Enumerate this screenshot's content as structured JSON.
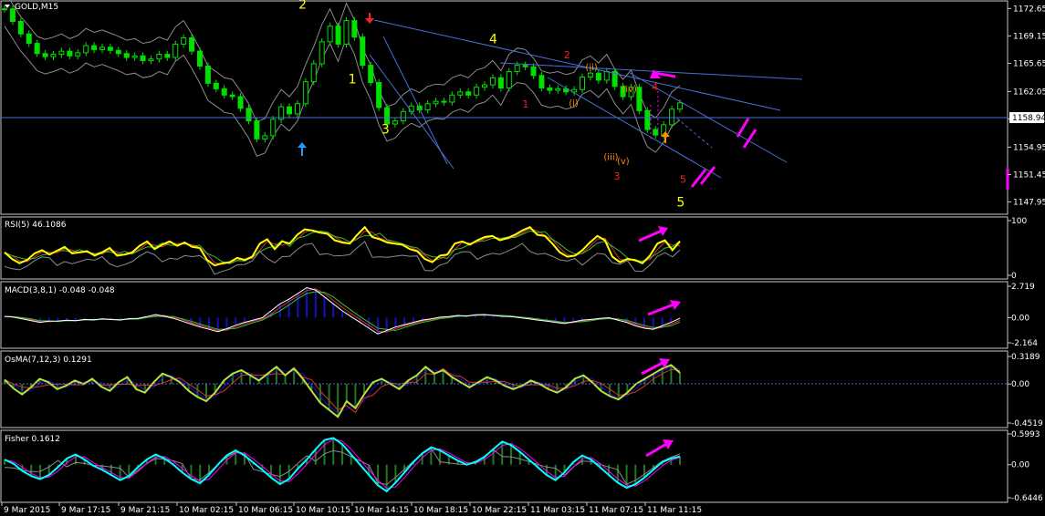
{
  "symbol_label": "GOLD,M15",
  "colors": {
    "background": "#000000",
    "frame": "#c8c8c8",
    "candle": "#00e000",
    "bands": "#8c8c8c",
    "trendline": "#4a6fd8",
    "current_price_line": "#4a6fd8",
    "arrow_annot": "#ff00ff",
    "rsi": "#ffff00",
    "histogram_blue": "#1010c8",
    "histogram_green": "#1f7a1f",
    "fisher_line": "#00ffff",
    "signal_magenta": "#ff00ff"
  },
  "chart_data": [
    {
      "type": "line",
      "panel": "main",
      "subtitle": "GOLD,M15",
      "y_ticks": [
        "1172.65",
        "1169.15",
        "1165.65",
        "1162.05",
        "1158.55",
        "1154.95",
        "1151.45",
        "1147.95"
      ],
      "current_price": "1158.94",
      "ylim": [
        1146.5,
        1173.5
      ],
      "series": [
        {
          "kind": "candles",
          "values": [
            1172.6,
            1171.0,
            1169.4,
            1168.2,
            1166.9,
            1166.5,
            1166.8,
            1167.2,
            1166.6,
            1167.0,
            1167.9,
            1167.4,
            1167.7,
            1167.3,
            1166.9,
            1166.4,
            1166.6,
            1166.0,
            1166.2,
            1166.8,
            1166.4,
            1168.1,
            1168.9,
            1167.2,
            1165.3,
            1163.1,
            1162.4,
            1161.6,
            1161.4,
            1159.9,
            1158.3,
            1156.0,
            1156.4,
            1158.5,
            1160.1,
            1159.2,
            1160.5,
            1163.3,
            1165.6,
            1168.4,
            1170.4,
            1168.1,
            1171.1,
            1169.0,
            1165.4,
            1163.2,
            1160.0,
            1157.9,
            1158.3,
            1159.5,
            1160.2,
            1159.7,
            1160.5,
            1160.8,
            1160.7,
            1161.6,
            1162.0,
            1161.6,
            1162.6,
            1162.9,
            1163.8,
            1162.5,
            1164.6,
            1165.4,
            1165.2,
            1164.1,
            1162.5,
            1162.2,
            1162.4,
            1162.0,
            1162.3,
            1163.9,
            1164.4,
            1163.5,
            1164.6,
            1162.7,
            1161.4,
            1162.6,
            1159.6,
            1157.2,
            1156.5,
            1157.8,
            1159.8,
            1160.6
          ]
        }
      ],
      "annotations": [
        {
          "text": "2",
          "color": "#ffff00",
          "x": 18.0,
          "y": 1172.6
        },
        {
          "text": "1",
          "color": "#ffff00",
          "x": 21.0,
          "y": 1163.1
        },
        {
          "text": "3",
          "color": "#ffff00",
          "x": 23.0,
          "y": 1156.7
        },
        {
          "text": "4",
          "color": "#ffff00",
          "x": 29.5,
          "y": 1168.2
        },
        {
          "text": "5",
          "color": "#ffff00",
          "x": 40.8,
          "y": 1147.4
        },
        {
          "text": "1",
          "color": "#ff2020",
          "x": 31.5,
          "y": 1160.0
        },
        {
          "text": "2",
          "color": "#ff2020",
          "x": 34.0,
          "y": 1166.3
        },
        {
          "text": "3",
          "color": "#ff2020",
          "x": 37.0,
          "y": 1150.8
        },
        {
          "text": "4",
          "color": "#ff2020",
          "x": 39.3,
          "y": 1162.2
        },
        {
          "text": "5",
          "color": "#ff2020",
          "x": 41.0,
          "y": 1150.4
        },
        {
          "text": "(i)",
          "color": "#ff8c00",
          "x": 34.3,
          "y": 1160.2
        },
        {
          "text": "(ii)",
          "color": "#ff8c00",
          "x": 35.3,
          "y": 1164.8
        },
        {
          "text": "(iii)",
          "color": "#ff8c00",
          "x": 36.4,
          "y": 1153.3
        },
        {
          "text": "(iv)",
          "color": "#ff8c00",
          "x": 37.5,
          "y": 1162.0
        },
        {
          "text": "(v)",
          "color": "#ff8c00",
          "x": 37.2,
          "y": 1152.8
        }
      ]
    },
    {
      "type": "line",
      "panel": "rsi",
      "subtitle": "RSI(5) 46.1086",
      "y_ticks": [
        "100",
        "0"
      ],
      "ylim": [
        0,
        100
      ],
      "series": [
        {
          "kind": "main",
          "values": [
            42,
            30,
            22,
            28,
            40,
            46,
            38,
            45,
            52,
            40,
            42,
            44,
            36,
            42,
            50,
            36,
            38,
            42,
            54,
            62,
            48,
            56,
            62,
            54,
            60,
            52,
            50,
            28,
            18,
            22,
            24,
            32,
            28,
            34,
            58,
            66,
            48,
            62,
            58,
            74,
            84,
            82,
            78,
            76,
            64,
            60,
            58,
            74,
            88,
            70,
            66,
            60,
            58,
            56,
            48,
            44,
            30,
            24,
            36,
            38,
            58,
            62,
            56,
            64,
            70,
            72,
            64,
            68,
            74,
            82,
            88,
            74,
            72,
            58,
            42,
            34,
            36,
            46,
            60,
            72,
            64,
            34,
            24,
            30,
            28,
            22,
            36,
            58,
            64,
            46,
            62
          ]
        }
      ]
    },
    {
      "type": "line",
      "panel": "macd",
      "subtitle": "MACD(3,8,1) -0.048 -0.048",
      "y_ticks": [
        "2.719",
        "0.00",
        "-2.164"
      ],
      "ylim": [
        -2.164,
        2.719
      ],
      "series": [
        {
          "kind": "macd",
          "values": [
            0.12,
            0.05,
            -0.1,
            -0.25,
            -0.4,
            -0.3,
            -0.28,
            -0.22,
            -0.25,
            -0.15,
            -0.18,
            -0.1,
            -0.15,
            -0.2,
            -0.08,
            -0.05,
            0.1,
            0.28,
            0.12,
            -0.05,
            -0.3,
            -0.55,
            -0.8,
            -1.0,
            -1.2,
            -0.95,
            -0.65,
            -0.4,
            -0.2,
            0.0,
            0.6,
            1.2,
            1.6,
            2.1,
            2.6,
            2.4,
            1.8,
            1.2,
            0.6,
            0.1,
            -0.4,
            -0.9,
            -1.4,
            -1.1,
            -0.8,
            -0.6,
            -0.4,
            -0.2,
            -0.1,
            0.05,
            0.1,
            0.2,
            0.15,
            0.25,
            0.28,
            0.2,
            0.12,
            0.1,
            0.0,
            -0.1,
            -0.2,
            -0.3,
            -0.4,
            -0.5,
            -0.35,
            -0.2,
            -0.15,
            -0.05,
            0.0,
            -0.2,
            -0.4,
            -0.7,
            -0.9,
            -1.0,
            -0.7,
            -0.4,
            -0.048
          ]
        }
      ]
    },
    {
      "type": "line",
      "panel": "osma",
      "subtitle": "OsMA(7,12,3) 0.1291",
      "y_ticks": [
        "0.3189",
        "0.00",
        "-0.4519"
      ],
      "ylim": [
        -0.4519,
        0.3189
      ],
      "series": [
        {
          "kind": "main",
          "values": [
            0.05,
            -0.05,
            -0.12,
            -0.04,
            0.06,
            0.02,
            -0.06,
            -0.02,
            0.04,
            0.0,
            0.06,
            -0.03,
            -0.08,
            0.02,
            0.08,
            -0.06,
            -0.1,
            0.02,
            0.12,
            0.08,
            0.02,
            -0.08,
            -0.15,
            -0.2,
            -0.1,
            0.04,
            0.12,
            0.16,
            0.1,
            0.04,
            0.12,
            0.2,
            0.1,
            0.18,
            0.06,
            -0.08,
            -0.22,
            -0.3,
            -0.38,
            -0.2,
            -0.28,
            -0.12,
            0.02,
            0.06,
            0.0,
            -0.06,
            0.04,
            0.1,
            0.2,
            0.12,
            0.16,
            0.08,
            0.02,
            -0.04,
            0.02,
            0.08,
            0.04,
            -0.02,
            -0.06,
            -0.02,
            0.04,
            0.0,
            -0.06,
            -0.1,
            -0.04,
            0.06,
            0.1,
            0.02,
            -0.08,
            -0.14,
            -0.18,
            -0.1,
            0.0,
            0.06,
            0.12,
            0.18,
            0.22,
            0.1291
          ]
        }
      ]
    },
    {
      "type": "line",
      "panel": "fisher",
      "subtitle": "Fisher 0.1612",
      "y_ticks": [
        "0.5993",
        "0.00",
        "-0.6446"
      ],
      "ylim": [
        -0.6446,
        0.5993
      ],
      "series": [
        {
          "kind": "main",
          "values": [
            0.1,
            0.02,
            -0.12,
            -0.22,
            -0.28,
            -0.2,
            -0.05,
            0.12,
            0.2,
            0.1,
            -0.02,
            -0.1,
            -0.2,
            -0.3,
            -0.22,
            -0.05,
            0.1,
            0.2,
            0.12,
            0.0,
            -0.15,
            -0.28,
            -0.36,
            -0.2,
            0.0,
            0.18,
            0.28,
            0.18,
            0.04,
            -0.1,
            -0.25,
            -0.38,
            -0.28,
            -0.08,
            0.1,
            0.3,
            0.48,
            0.52,
            0.4,
            0.2,
            0.0,
            -0.2,
            -0.4,
            -0.52,
            -0.35,
            -0.15,
            0.05,
            0.22,
            0.34,
            0.28,
            0.18,
            0.08,
            0.0,
            0.05,
            0.15,
            0.3,
            0.45,
            0.38,
            0.25,
            0.1,
            -0.05,
            -0.2,
            -0.3,
            -0.15,
            0.05,
            0.18,
            0.1,
            -0.05,
            -0.2,
            -0.35,
            -0.45,
            -0.38,
            -0.25,
            -0.1,
            0.05,
            0.12,
            0.1612
          ]
        }
      ]
    }
  ],
  "x_axis": {
    "labels": [
      "9 Mar 2015",
      "9 Mar 17:15",
      "9 Mar 21:15",
      "10 Mar 02:15",
      "10 Mar 06:15",
      "10 Mar 10:15",
      "10 Mar 14:15",
      "10 Mar 18:15",
      "10 Mar 22:15",
      "11 Mar 03:15",
      "11 Mar 07:15",
      "11 Mar 11:15"
    ]
  }
}
